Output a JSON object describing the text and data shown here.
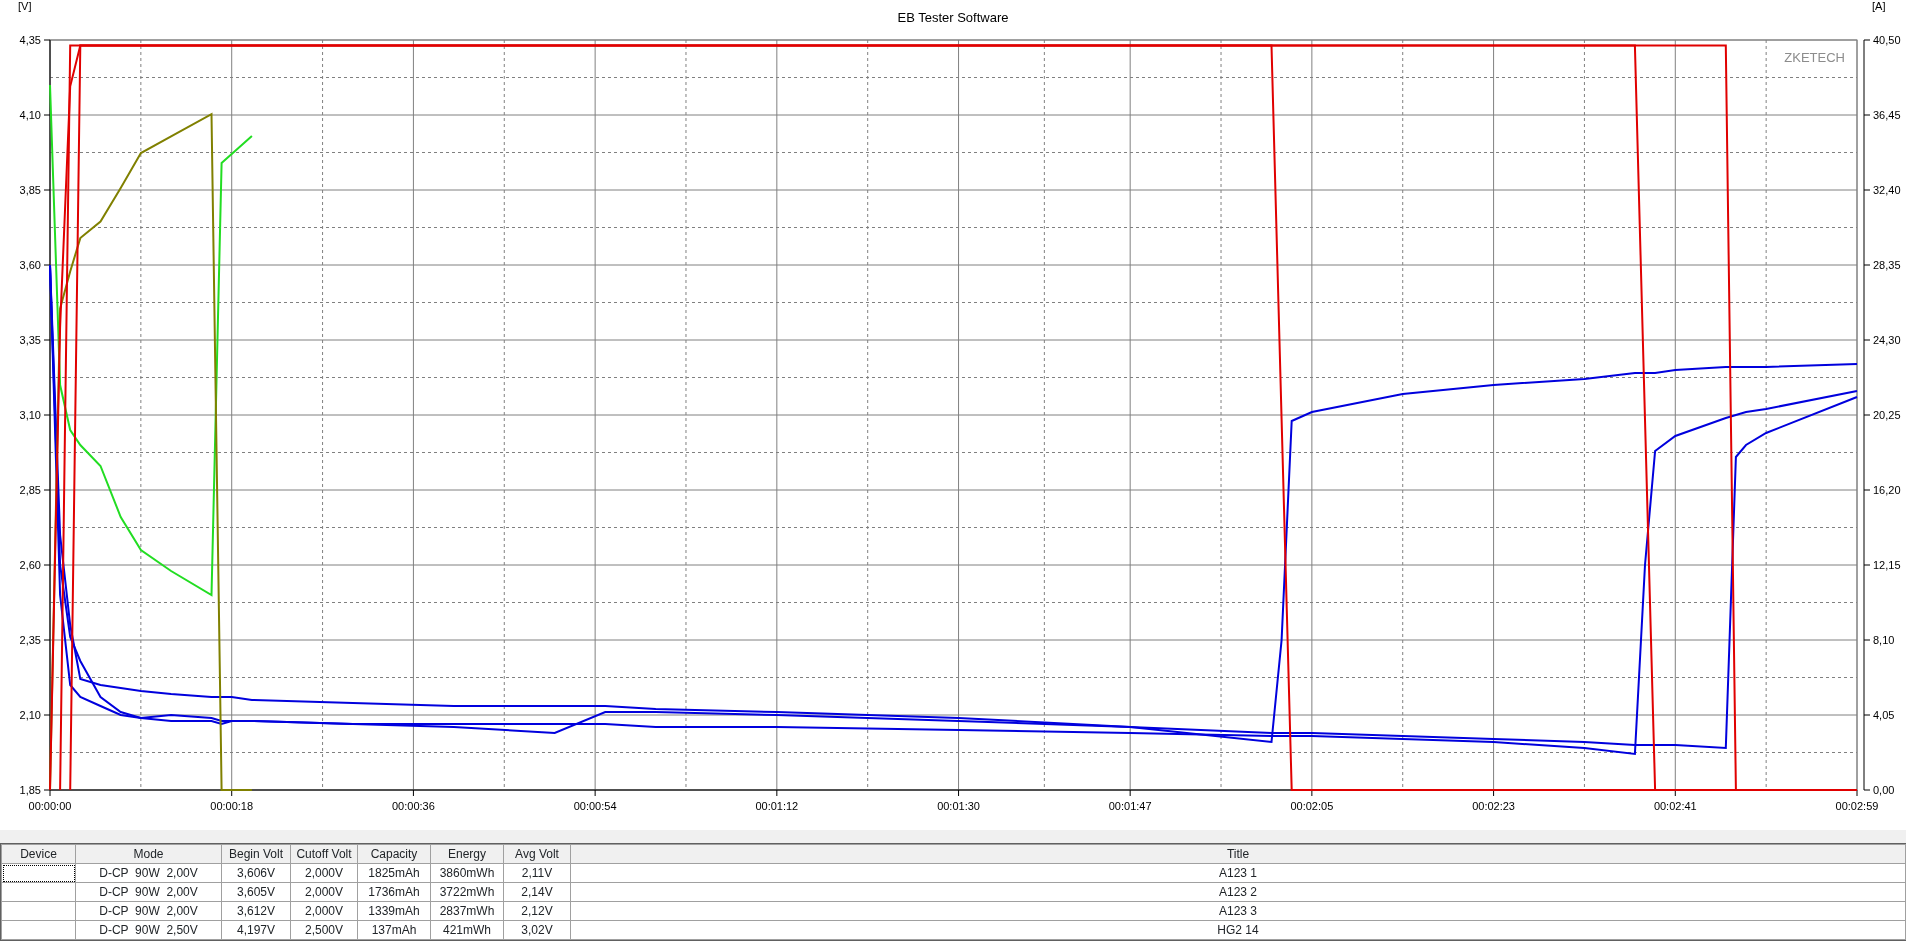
{
  "chart": {
    "chart_data": {
      "type": "line",
      "grid": true,
      "title": "EB Tester Software",
      "ylabel": "[V]",
      "y2label": "[A]",
      "x": [
        0,
        1,
        2,
        3,
        5,
        7,
        9,
        12,
        16,
        17,
        18,
        20,
        30,
        40,
        50,
        55,
        60,
        72,
        90,
        107,
        121,
        122,
        123,
        125,
        134,
        143,
        152,
        157,
        158,
        159,
        161,
        166,
        167,
        168,
        170,
        179
      ],
      "xlim": [
        0,
        179
      ],
      "ylim": [
        1.85,
        4.35
      ],
      "y2lim": [
        0,
        40.5
      ],
      "xticks": [
        {
          "value": 0,
          "label": "00:00:00"
        },
        {
          "value": 18,
          "label": "00:00:18"
        },
        {
          "value": 36,
          "label": "00:00:36"
        },
        {
          "value": 54,
          "label": "00:00:54"
        },
        {
          "value": 72,
          "label": "00:01:12"
        },
        {
          "value": 90,
          "label": "00:01:30"
        },
        {
          "value": 107,
          "label": "00:01:47"
        },
        {
          "value": 125,
          "label": "00:02:05"
        },
        {
          "value": 143,
          "label": "00:02:23"
        },
        {
          "value": 161,
          "label": "00:02:41"
        },
        {
          "value": 179,
          "label": "00:02:59"
        }
      ],
      "yticks": [
        {
          "value": 1.85,
          "label": "1,85"
        },
        {
          "value": 2.1,
          "label": "2,10"
        },
        {
          "value": 2.35,
          "label": "2,35"
        },
        {
          "value": 2.6,
          "label": "2,60"
        },
        {
          "value": 2.85,
          "label": "2,85"
        },
        {
          "value": 3.1,
          "label": "3,10"
        },
        {
          "value": 3.35,
          "label": "3,35"
        },
        {
          "value": 3.6,
          "label": "3,60"
        },
        {
          "value": 3.85,
          "label": "3,85"
        },
        {
          "value": 4.1,
          "label": "4,10"
        },
        {
          "value": 4.35,
          "label": "4,35"
        }
      ],
      "y2ticks": [
        {
          "value": 0,
          "label": "0,00"
        },
        {
          "value": 4.05,
          "label": "4,05"
        },
        {
          "value": 8.1,
          "label": "8,10"
        },
        {
          "value": 12.15,
          "label": "12,15"
        },
        {
          "value": 16.2,
          "label": "16,20"
        },
        {
          "value": 20.25,
          "label": "20,25"
        },
        {
          "value": 24.3,
          "label": "24,30"
        },
        {
          "value": 28.35,
          "label": "28,35"
        },
        {
          "value": 32.4,
          "label": "32,40"
        },
        {
          "value": 36.45,
          "label": "36,45"
        },
        {
          "value": 40.5,
          "label": "40,50"
        }
      ],
      "annotations": [
        {
          "text": "ZKETECH"
        }
      ],
      "series": [
        {
          "color": "#0000dd",
          "values": [
            3.6,
            2.7,
            2.4,
            2.22,
            2.2,
            2.19,
            2.18,
            2.17,
            2.16,
            2.16,
            2.16,
            2.15,
            2.14,
            2.13,
            2.13,
            2.13,
            2.12,
            2.11,
            2.09,
            2.06,
            2.01,
            2.35,
            3.08,
            3.11,
            3.17,
            3.2,
            3.22,
            3.24,
            3.24,
            3.24,
            3.25,
            3.26,
            3.26,
            3.26,
            3.26,
            3.27
          ]
        },
        {
          "color": "#0000dd",
          "values": [
            3.6,
            2.6,
            2.36,
            2.28,
            2.16,
            2.11,
            2.09,
            2.1,
            2.09,
            2.08,
            2.08,
            2.08,
            2.07,
            2.07,
            2.07,
            2.07,
            2.06,
            2.06,
            2.05,
            2.04,
            2.03,
            2.03,
            2.03,
            2.03,
            2.02,
            2.01,
            1.99,
            1.97,
            2.6,
            2.98,
            3.03,
            3.09,
            3.1,
            3.11,
            3.12,
            3.18
          ]
        },
        {
          "color": "#0000dd",
          "values": [
            3.6,
            2.5,
            2.2,
            2.16,
            2.13,
            2.1,
            2.09,
            2.08,
            2.08,
            2.07,
            2.08,
            2.08,
            2.07,
            2.06,
            2.04,
            2.11,
            2.11,
            2.1,
            2.08,
            2.06,
            2.04,
            2.04,
            2.04,
            2.04,
            2.03,
            2.02,
            2.01,
            2,
            2,
            2,
            2,
            1.99,
            2.96,
            3,
            3.04,
            3.16
          ]
        },
        {
          "color": "#22dd22",
          "values": [
            4.2,
            3.2,
            3.05,
            3,
            2.93,
            2.76,
            2.65,
            2.58,
            2.5,
            3.94,
            3.97,
            4.03,
            null,
            null,
            null,
            null,
            null,
            null,
            null,
            null,
            null,
            null,
            null,
            null,
            null,
            null,
            null,
            null,
            null,
            null,
            null,
            null,
            null,
            null,
            null,
            null
          ]
        },
        {
          "color": "#808000",
          "axis": "y2",
          "values": [
            0,
            26,
            28,
            29.8,
            30.7,
            32.5,
            34.4,
            35.3,
            36.5,
            0,
            0,
            0,
            null,
            null,
            null,
            null,
            null,
            null,
            null,
            null,
            null,
            null,
            null,
            null,
            null,
            null,
            null,
            null,
            null,
            null,
            null,
            null,
            null,
            null,
            null,
            null
          ]
        },
        {
          "color": "#e00000",
          "axis": "y2",
          "values": [
            0,
            25,
            38,
            40.2,
            40.2,
            40.2,
            40.2,
            40.2,
            40.2,
            40.2,
            40.2,
            40.2,
            40.2,
            40.2,
            40.2,
            40.2,
            40.2,
            40.2,
            40.2,
            40.2,
            40.2,
            20,
            0,
            0,
            0,
            0,
            0,
            0,
            0,
            0,
            0,
            0,
            0,
            0,
            0,
            0
          ]
        },
        {
          "color": "#e00000",
          "axis": "y2",
          "values": [
            null,
            0,
            40.2,
            40.2,
            40.2,
            40.2,
            40.2,
            40.2,
            40.2,
            40.2,
            40.2,
            40.2,
            40.2,
            40.2,
            40.2,
            40.2,
            40.2,
            40.2,
            40.2,
            40.2,
            40.2,
            40.2,
            40.2,
            40.2,
            40.2,
            40.2,
            40.2,
            40.2,
            20,
            0,
            0,
            0,
            0,
            0,
            0,
            0
          ]
        },
        {
          "color": "#e00000",
          "axis": "y2",
          "values": [
            null,
            null,
            0,
            40.2,
            40.2,
            40.2,
            40.2,
            40.2,
            40.2,
            40.2,
            40.2,
            40.2,
            40.2,
            40.2,
            40.2,
            40.2,
            40.2,
            40.2,
            40.2,
            40.2,
            40.2,
            40.2,
            40.2,
            40.2,
            40.2,
            40.2,
            40.2,
            40.2,
            40.2,
            40.2,
            40.2,
            40.2,
            0,
            0,
            0,
            0
          ]
        }
      ]
    }
  },
  "table": {
    "columns": [
      "Device",
      "Mode",
      "Begin Volt",
      "Cutoff Volt",
      "Capacity",
      "Energy",
      "Avg Volt",
      "Title"
    ],
    "rows": [
      {
        "focus": true,
        "cells": [
          "",
          "D-CP  90W  2,00V",
          "3,606V",
          "2,000V",
          "1825mAh",
          "3860mWh",
          "2,11V",
          "A123 1"
        ]
      },
      {
        "focus": false,
        "cells": [
          "",
          "D-CP  90W  2,00V",
          "3,605V",
          "2,000V",
          "1736mAh",
          "3722mWh",
          "2,14V",
          "A123 2"
        ]
      },
      {
        "focus": false,
        "cells": [
          "",
          "D-CP  90W  2,00V",
          "3,612V",
          "2,000V",
          "1339mAh",
          "2837mWh",
          "2,12V",
          "A123 3"
        ]
      },
      {
        "focus": false,
        "cells": [
          "",
          "D-CP  90W  2,50V",
          "4,197V",
          "2,500V",
          "137mAh",
          "421mWh",
          "3,02V",
          "HG2 14"
        ]
      }
    ]
  }
}
